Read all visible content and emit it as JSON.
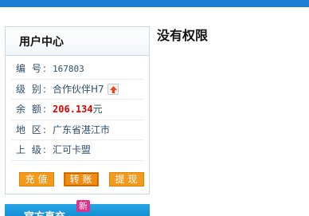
{
  "user_center": {
    "title": "用户中心",
    "rows": [
      {
        "label": "编 号:",
        "value": "167803"
      },
      {
        "label": "级 别:",
        "value": "合作伙伴H7"
      },
      {
        "label": "余 额:",
        "value": "206.134",
        "unit": "元"
      },
      {
        "label": "地 区:",
        "value": "广东省湛江市"
      },
      {
        "label": "上 级:",
        "value": "汇可卡盟"
      }
    ],
    "buttons": {
      "recharge": "充值",
      "transfer": "转账",
      "withdraw": "提现"
    },
    "level_icon": "upgrade-arrow-icon"
  },
  "bottom_panel": {
    "title": "官方直充",
    "badge": "新"
  },
  "main": {
    "message": "没有权限"
  },
  "colors": {
    "top_bar": "#1a7fd6",
    "button": "#f39a1d",
    "balance": "#e00000",
    "badge": "#e0308a"
  }
}
